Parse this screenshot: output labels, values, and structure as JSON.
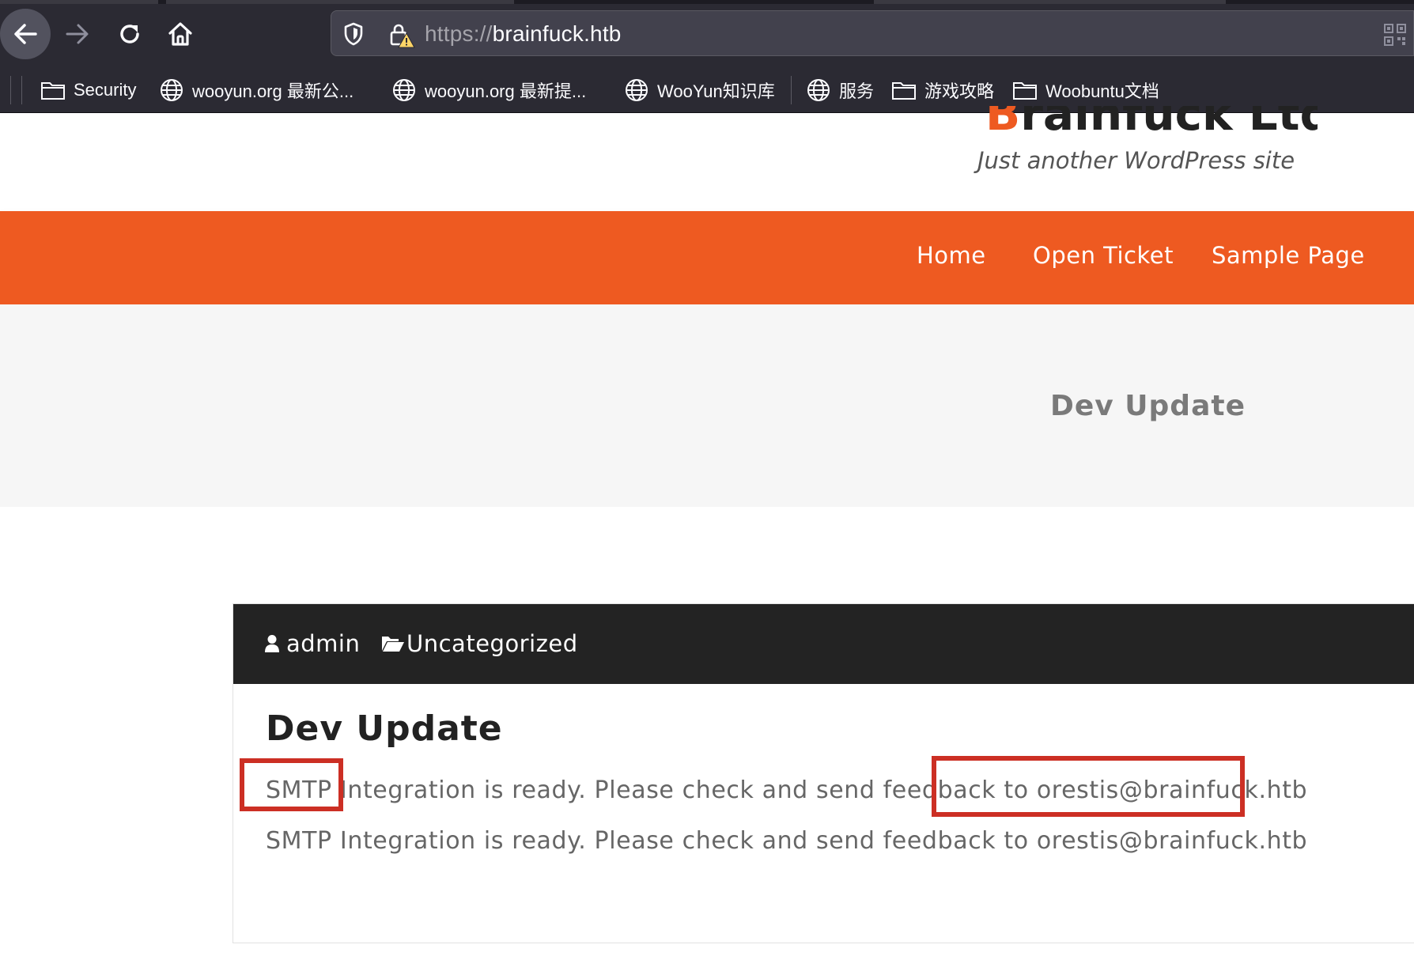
{
  "browser": {
    "url_scheme": "https://",
    "url_host": "brainfuck.htb",
    "bookmarks": [
      {
        "label": "Security",
        "icon": "folder-icon"
      },
      {
        "label": "wooyun.org 最新公...",
        "icon": "globe-icon"
      },
      {
        "label": "wooyun.org 最新提...",
        "icon": "globe-icon"
      },
      {
        "label": "WooYun知识库",
        "icon": "globe-icon"
      },
      {
        "label": "服务",
        "icon": "globe-icon"
      },
      {
        "label": "游戏攻略",
        "icon": "folder-icon"
      },
      {
        "label": "Woobuntu文档",
        "icon": "folder-icon"
      }
    ]
  },
  "site": {
    "title_first_letter": "B",
    "title_rest": "rainfuck Ltd.",
    "tagline": "Just another WordPress site",
    "accent_color": "#ee5a21",
    "nav": [
      {
        "label": "Home"
      },
      {
        "label": "Open Ticket"
      },
      {
        "label": "Sample Page"
      }
    ]
  },
  "hero": {
    "title": "Dev Update"
  },
  "post": {
    "author": "admin",
    "category": "Uncategorized",
    "title": "Dev Update",
    "lines": [
      "SMTP Integration is ready. Please check and send feedback to orestis@brainfuck.htb",
      "SMTP Integration is ready. Please check and send feedback to orestis@brainfuck.htb"
    ],
    "highlight_color": "#cc2f24"
  }
}
